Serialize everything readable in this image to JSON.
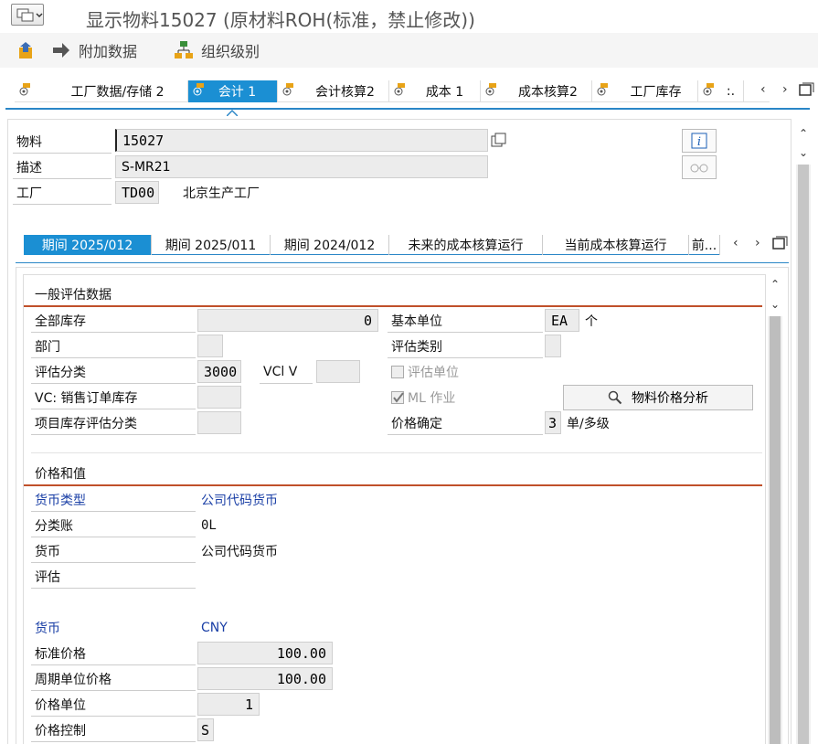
{
  "window": {
    "title": "显示物料15027 (原材料ROH(标准，禁止修改))"
  },
  "toolbar": {
    "items": [
      {
        "label": "",
        "icon": "export-icon"
      },
      {
        "label": "附加数据",
        "icon": "arrow-right-icon"
      },
      {
        "label": "组织级别",
        "icon": "org-hierarchy-icon"
      }
    ]
  },
  "view_tabs": [
    {
      "label": "工厂数据/存储 2",
      "active": false
    },
    {
      "label": "会计 1",
      "active": true
    },
    {
      "label": "会计核算2",
      "active": false
    },
    {
      "label": "成本 1",
      "active": false
    },
    {
      "label": "成本核算2",
      "active": false
    },
    {
      "label": "工厂库存",
      "active": false
    },
    {
      "label": ":.",
      "active": false
    }
  ],
  "header": {
    "material_label": "物料",
    "material_value": "15027",
    "desc_label": "描述",
    "desc_value": "S-MR21",
    "plant_label": "工厂",
    "plant_value": "TD00",
    "plant_name": "北京生产工厂"
  },
  "period_tabs": [
    {
      "label": "期间 2025/012",
      "active": true
    },
    {
      "label": "期间 2025/011",
      "active": false
    },
    {
      "label": "期间 2024/012",
      "active": false
    },
    {
      "label": "未来的成本核算运行",
      "active": false
    },
    {
      "label": "当前成本核算运行",
      "active": false
    },
    {
      "label": "前...",
      "active": false
    }
  ],
  "general_valuation": {
    "title": "一般评估数据",
    "total_stock_label": "全部库存",
    "total_stock_value": "0",
    "division_label": "部门",
    "division_value": "",
    "valuation_class_label": "评估分类",
    "valuation_class_value": "3000",
    "vc_label": "VC: 销售订单库存",
    "vc_value": "",
    "proj_label": "项目库存评估分类",
    "proj_value": "",
    "vclv_label": "VCl V",
    "vclv_value": "",
    "base_unit_label": "基本单位",
    "base_unit_value": "EA",
    "base_unit_text": "个",
    "valuation_cat_label": "评估类别",
    "valuation_cat_value": "",
    "valuated_unit_label": "评估单位",
    "ml_label": "ML 作业",
    "ml_checked": true,
    "price_analysis_button": "物料价格分析",
    "price_det_label": "价格确定",
    "price_det_value": "3",
    "price_det_text": "单/多级"
  },
  "prices": {
    "title": "价格和值",
    "currency_type_label": "货币类型",
    "currency_type_value": "公司代码货币",
    "ledger_label": "分类账",
    "ledger_value": "0L",
    "currency_label": "货币",
    "currency_value": "公司代码货币",
    "valuation_label": "评估",
    "valuation_value": "",
    "currency2_label": "货币",
    "currency2_value": "CNY",
    "std_price_label": "标准价格",
    "std_price_value": "100.00",
    "period_price_label": "周期单位价格",
    "period_price_value": "100.00",
    "price_unit_label": "价格单位",
    "price_unit_value": "1",
    "price_control_label": "价格控制",
    "price_control_value": "S"
  },
  "colors": {
    "accent": "#1b8fd3",
    "section_line": "#c0502a",
    "link_blue": "#1a3fa6"
  }
}
